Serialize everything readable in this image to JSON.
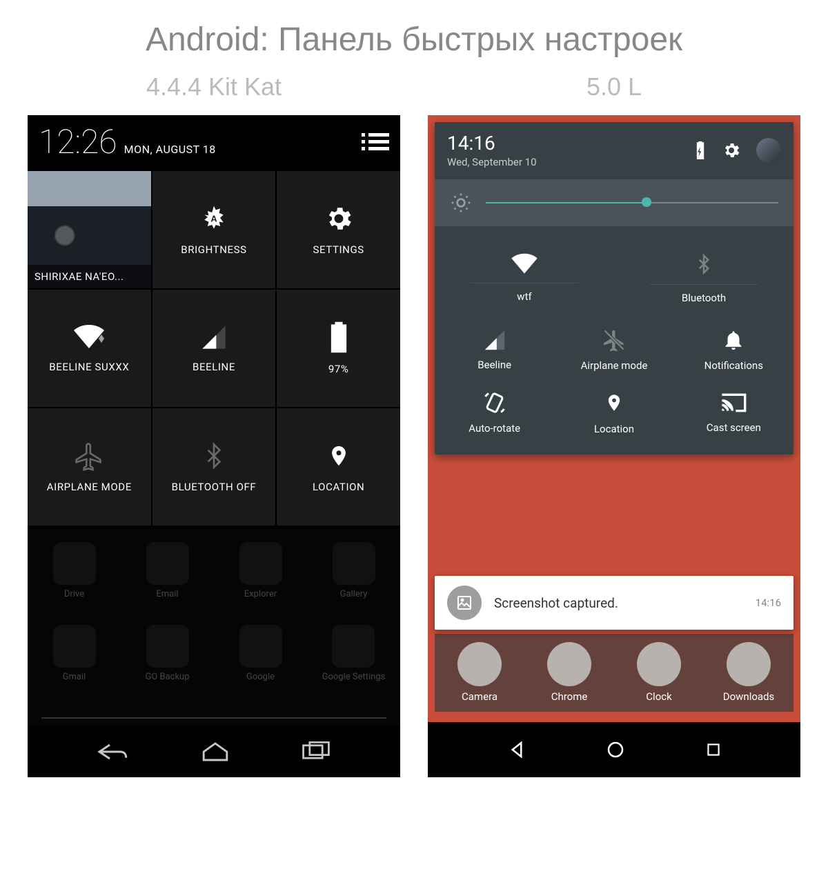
{
  "title": "Android: Панель быстрых настроек",
  "left": {
    "version_label": "4.4.4 Kit Kat",
    "time": "12:26",
    "date": "MON, AUGUST 18",
    "profile_name": "SHIRIXAE NA'EO...",
    "tiles": [
      {
        "name": "brightness",
        "label": "BRIGHTNESS"
      },
      {
        "name": "settings",
        "label": "SETTINGS"
      },
      {
        "name": "wifi",
        "label": "BEELINE SUXXX"
      },
      {
        "name": "cellular",
        "label": "BEELINE"
      },
      {
        "name": "battery",
        "label": "97%"
      },
      {
        "name": "airplane",
        "label": "AIRPLANE MODE",
        "inactive": true
      },
      {
        "name": "bluetooth",
        "label": "BLUETOOTH OFF",
        "inactive": true
      },
      {
        "name": "location",
        "label": "LOCATION"
      }
    ],
    "background_apps": [
      "Drive",
      "Email",
      "Explorer",
      "Gallery",
      "Gmail",
      "GO Backup",
      "Google",
      "Google Settings"
    ]
  },
  "right": {
    "version_label": "5.0 L",
    "time": "14:16",
    "date": "Wed, September 10",
    "brightness_percent": 55,
    "tiles_top": [
      {
        "name": "wifi",
        "label": "wtf"
      },
      {
        "name": "bluetooth",
        "label": "Bluetooth",
        "inactive": true
      }
    ],
    "tiles": [
      {
        "name": "cellular",
        "label": "Beeline"
      },
      {
        "name": "airplane",
        "label": "Airplane mode",
        "inactive": true
      },
      {
        "name": "notifications",
        "label": "Notifications"
      },
      {
        "name": "autorotate",
        "label": "Auto-rotate"
      },
      {
        "name": "location",
        "label": "Location"
      },
      {
        "name": "cast",
        "label": "Cast screen"
      }
    ],
    "notification": {
      "title": "Screenshot captured.",
      "time": "14:16"
    },
    "background_apps": [
      "Camera",
      "Chrome",
      "Clock",
      "Downloads"
    ]
  }
}
